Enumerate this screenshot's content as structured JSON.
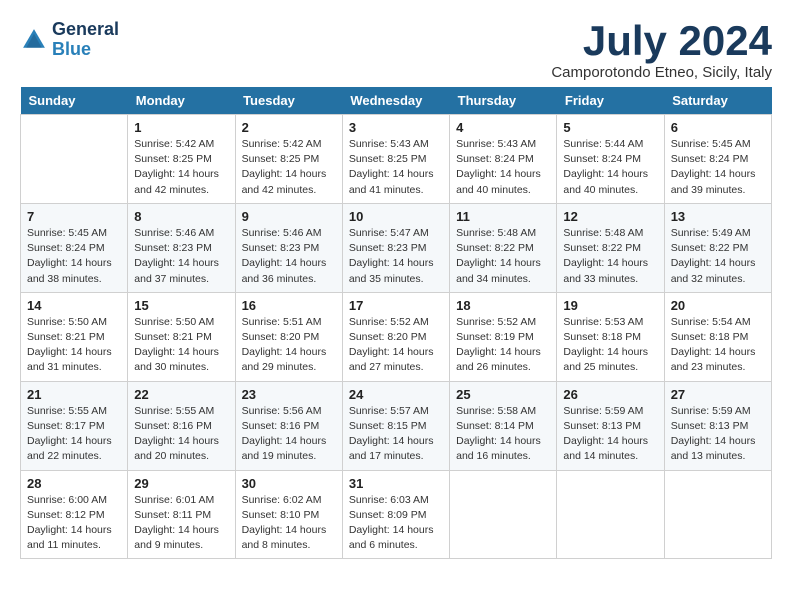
{
  "header": {
    "logo_line1": "General",
    "logo_line2": "Blue",
    "month_title": "July 2024",
    "location": "Camporotondo Etneo, Sicily, Italy"
  },
  "weekdays": [
    "Sunday",
    "Monday",
    "Tuesday",
    "Wednesday",
    "Thursday",
    "Friday",
    "Saturday"
  ],
  "weeks": [
    [
      {
        "day": "",
        "info": ""
      },
      {
        "day": "1",
        "info": "Sunrise: 5:42 AM\nSunset: 8:25 PM\nDaylight: 14 hours\nand 42 minutes."
      },
      {
        "day": "2",
        "info": "Sunrise: 5:42 AM\nSunset: 8:25 PM\nDaylight: 14 hours\nand 42 minutes."
      },
      {
        "day": "3",
        "info": "Sunrise: 5:43 AM\nSunset: 8:25 PM\nDaylight: 14 hours\nand 41 minutes."
      },
      {
        "day": "4",
        "info": "Sunrise: 5:43 AM\nSunset: 8:24 PM\nDaylight: 14 hours\nand 40 minutes."
      },
      {
        "day": "5",
        "info": "Sunrise: 5:44 AM\nSunset: 8:24 PM\nDaylight: 14 hours\nand 40 minutes."
      },
      {
        "day": "6",
        "info": "Sunrise: 5:45 AM\nSunset: 8:24 PM\nDaylight: 14 hours\nand 39 minutes."
      }
    ],
    [
      {
        "day": "7",
        "info": "Sunrise: 5:45 AM\nSunset: 8:24 PM\nDaylight: 14 hours\nand 38 minutes."
      },
      {
        "day": "8",
        "info": "Sunrise: 5:46 AM\nSunset: 8:23 PM\nDaylight: 14 hours\nand 37 minutes."
      },
      {
        "day": "9",
        "info": "Sunrise: 5:46 AM\nSunset: 8:23 PM\nDaylight: 14 hours\nand 36 minutes."
      },
      {
        "day": "10",
        "info": "Sunrise: 5:47 AM\nSunset: 8:23 PM\nDaylight: 14 hours\nand 35 minutes."
      },
      {
        "day": "11",
        "info": "Sunrise: 5:48 AM\nSunset: 8:22 PM\nDaylight: 14 hours\nand 34 minutes."
      },
      {
        "day": "12",
        "info": "Sunrise: 5:48 AM\nSunset: 8:22 PM\nDaylight: 14 hours\nand 33 minutes."
      },
      {
        "day": "13",
        "info": "Sunrise: 5:49 AM\nSunset: 8:22 PM\nDaylight: 14 hours\nand 32 minutes."
      }
    ],
    [
      {
        "day": "14",
        "info": "Sunrise: 5:50 AM\nSunset: 8:21 PM\nDaylight: 14 hours\nand 31 minutes."
      },
      {
        "day": "15",
        "info": "Sunrise: 5:50 AM\nSunset: 8:21 PM\nDaylight: 14 hours\nand 30 minutes."
      },
      {
        "day": "16",
        "info": "Sunrise: 5:51 AM\nSunset: 8:20 PM\nDaylight: 14 hours\nand 29 minutes."
      },
      {
        "day": "17",
        "info": "Sunrise: 5:52 AM\nSunset: 8:20 PM\nDaylight: 14 hours\nand 27 minutes."
      },
      {
        "day": "18",
        "info": "Sunrise: 5:52 AM\nSunset: 8:19 PM\nDaylight: 14 hours\nand 26 minutes."
      },
      {
        "day": "19",
        "info": "Sunrise: 5:53 AM\nSunset: 8:18 PM\nDaylight: 14 hours\nand 25 minutes."
      },
      {
        "day": "20",
        "info": "Sunrise: 5:54 AM\nSunset: 8:18 PM\nDaylight: 14 hours\nand 23 minutes."
      }
    ],
    [
      {
        "day": "21",
        "info": "Sunrise: 5:55 AM\nSunset: 8:17 PM\nDaylight: 14 hours\nand 22 minutes."
      },
      {
        "day": "22",
        "info": "Sunrise: 5:55 AM\nSunset: 8:16 PM\nDaylight: 14 hours\nand 20 minutes."
      },
      {
        "day": "23",
        "info": "Sunrise: 5:56 AM\nSunset: 8:16 PM\nDaylight: 14 hours\nand 19 minutes."
      },
      {
        "day": "24",
        "info": "Sunrise: 5:57 AM\nSunset: 8:15 PM\nDaylight: 14 hours\nand 17 minutes."
      },
      {
        "day": "25",
        "info": "Sunrise: 5:58 AM\nSunset: 8:14 PM\nDaylight: 14 hours\nand 16 minutes."
      },
      {
        "day": "26",
        "info": "Sunrise: 5:59 AM\nSunset: 8:13 PM\nDaylight: 14 hours\nand 14 minutes."
      },
      {
        "day": "27",
        "info": "Sunrise: 5:59 AM\nSunset: 8:13 PM\nDaylight: 14 hours\nand 13 minutes."
      }
    ],
    [
      {
        "day": "28",
        "info": "Sunrise: 6:00 AM\nSunset: 8:12 PM\nDaylight: 14 hours\nand 11 minutes."
      },
      {
        "day": "29",
        "info": "Sunrise: 6:01 AM\nSunset: 8:11 PM\nDaylight: 14 hours\nand 9 minutes."
      },
      {
        "day": "30",
        "info": "Sunrise: 6:02 AM\nSunset: 8:10 PM\nDaylight: 14 hours\nand 8 minutes."
      },
      {
        "day": "31",
        "info": "Sunrise: 6:03 AM\nSunset: 8:09 PM\nDaylight: 14 hours\nand 6 minutes."
      },
      {
        "day": "",
        "info": ""
      },
      {
        "day": "",
        "info": ""
      },
      {
        "day": "",
        "info": ""
      }
    ]
  ]
}
